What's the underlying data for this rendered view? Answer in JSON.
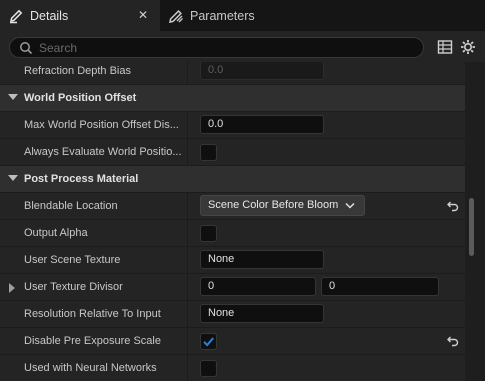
{
  "tabs": [
    {
      "label": "Details",
      "icon": "pencil-icon",
      "close": "✕"
    },
    {
      "label": "Parameters",
      "icon": "pencil-ruler-icon"
    }
  ],
  "search": {
    "placeholder": "Search",
    "value": ""
  },
  "toolbar": {
    "icons": [
      "table-icon",
      "gear-icon"
    ]
  },
  "rows": {
    "refraction_depth_bias": {
      "label": "Refraction Depth Bias",
      "value": "0.0"
    },
    "max_wpo_distance": {
      "label": "Max World Position Offset Dis...",
      "value": "0.0"
    },
    "always_evaluate_wpo": {
      "label": "Always Evaluate World Positio...",
      "checked": false
    },
    "blendable_location": {
      "label": "Blendable Location",
      "value": "Scene Color Before Bloom"
    },
    "output_alpha": {
      "label": "Output Alpha",
      "checked": false
    },
    "user_scene_texture": {
      "label": "User Scene Texture",
      "value": "None"
    },
    "user_texture_divisor": {
      "label": "User Texture Divisor",
      "x": "0",
      "y": "0"
    },
    "resolution_relative": {
      "label": "Resolution Relative To Input",
      "value": "None"
    },
    "disable_pre_exposure": {
      "label": "Disable Pre Exposure Scale",
      "checked": true
    },
    "neural_networks": {
      "label": "Used with Neural Networks",
      "checked": false
    }
  },
  "categories": {
    "wpo": "World Position Offset",
    "post_process": "Post Process Material"
  },
  "colors": {
    "accent": "#2f7fd9",
    "background": "#242424",
    "category": "#2f2f2f"
  }
}
